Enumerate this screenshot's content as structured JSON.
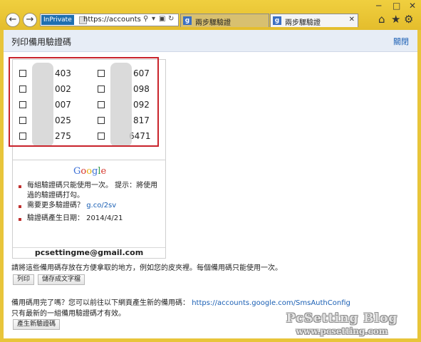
{
  "browser": {
    "address_badge": "InPrivate",
    "address_url": "https://accounts.g...",
    "tabs": [
      {
        "label": "兩步驟驗證",
        "active": false
      },
      {
        "label": "兩步驟驗證",
        "active": true
      }
    ],
    "minimize_glyph": "─",
    "maximize_glyph": "□",
    "close_glyph": "✕"
  },
  "page": {
    "title": "列印備用驗證碼",
    "close_link": "關閉"
  },
  "codes_left": [
    "403",
    "002",
    "007",
    "025",
    "275"
  ],
  "codes_right": [
    "607",
    "098",
    "092",
    "817",
    "6471"
  ],
  "card": {
    "logo": "Google",
    "notes": [
      "每組驗證碼只能使用一次。 提示：將使用過的驗證碼打勾。",
      "需要更多驗證碼？",
      "驗證碼產生日期： 2014/4/21"
    ],
    "more_link": "g.co/2sv",
    "email": "pcsettingme@gmail.com"
  },
  "instructions": "請將這些備用碼存放在方便拿取的地方，例如您的皮夾裡。每個備用碼只能使用一次。",
  "buttons": {
    "print": "列印",
    "save_text": "儲存成文字檔",
    "generate_new": "產生新驗證碼"
  },
  "regenerate": {
    "text": "備用碼用完了嗎？您可以前往以下網頁產生新的備用碼：",
    "link": "https://accounts.google.com/SmsAuthConfig",
    "note": "只有最新的一組備用驗證碼才有效。"
  },
  "watermark": {
    "line1": "PcSetting Blog",
    "line2": "www.pcsetting.com"
  },
  "colors": {
    "chrome": "#e8c53a",
    "highlight_border": "#c9232b",
    "link": "#1a5fb4",
    "bullet": "#c0302e"
  }
}
